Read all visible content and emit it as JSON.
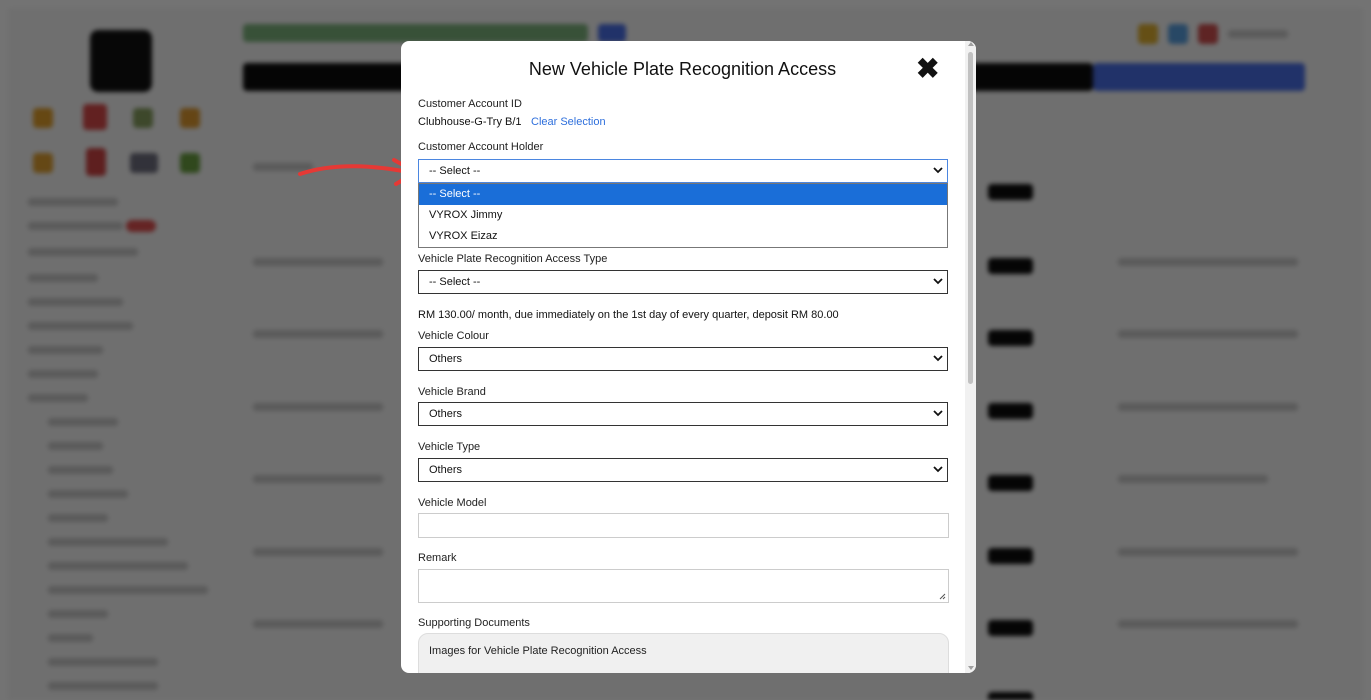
{
  "modal": {
    "title": "New Vehicle Plate Recognition Access",
    "close_icon": "close-icon",
    "customer_account_id": {
      "label": "Customer Account ID",
      "value": "Clubhouse-G-Try B/1",
      "clear_label": "Clear Selection"
    },
    "customer_account_holder": {
      "label": "Customer Account Holder",
      "selected": "-- Select --",
      "options": [
        "-- Select --",
        "VYROX Jimmy",
        "VYROX Eizaz"
      ]
    },
    "access_type": {
      "label": "Vehicle Plate Recognition Access Type",
      "selected": "-- Select --"
    },
    "pricing_note": "RM 130.00/ month, due immediately on the 1st day of every quarter, deposit RM 80.00",
    "vehicle_colour": {
      "label": "Vehicle Colour",
      "selected": "Others"
    },
    "vehicle_brand": {
      "label": "Vehicle Brand",
      "selected": "Others"
    },
    "vehicle_type": {
      "label": "Vehicle Type",
      "selected": "Others"
    },
    "vehicle_model": {
      "label": "Vehicle Model",
      "value": ""
    },
    "remark": {
      "label": "Remark",
      "value": ""
    },
    "supporting_documents": {
      "label": "Supporting Documents",
      "box_text": "Images for Vehicle Plate Recognition Access"
    }
  },
  "colors": {
    "accent": "#1a6ed8",
    "link": "#2e6fdc",
    "annotation_arrow": "#e53935"
  }
}
